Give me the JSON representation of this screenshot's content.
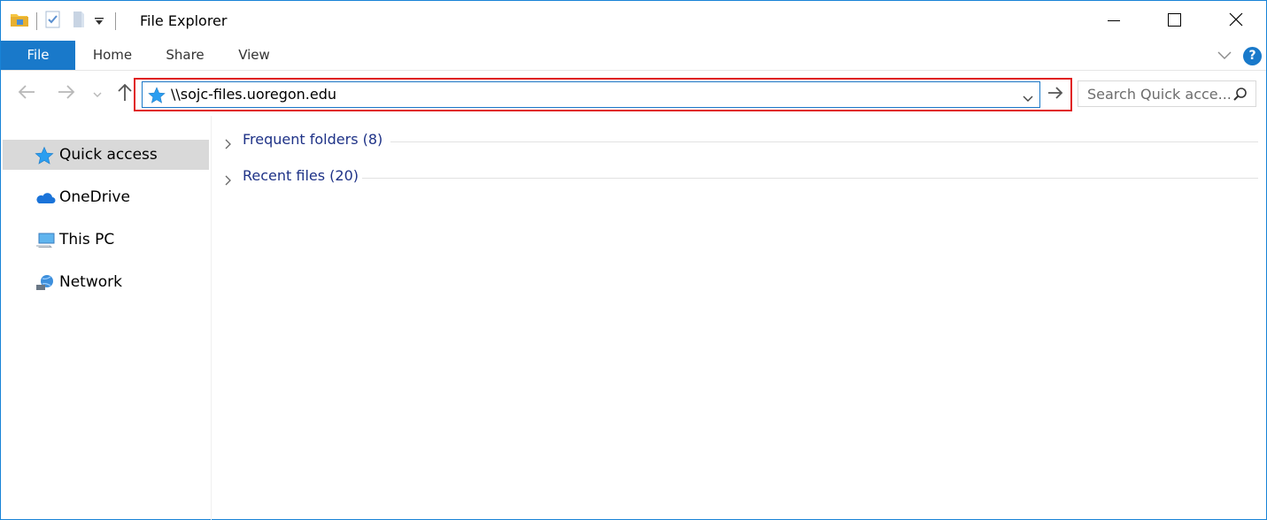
{
  "window": {
    "title": "File Explorer",
    "accent": "#1979ca"
  },
  "quick_access_toolbar": {
    "icons": [
      "folder-icon",
      "properties-checkbox-icon",
      "new-folder-icon",
      "customize-dropdown-icon"
    ]
  },
  "window_controls": [
    "minimize",
    "maximize",
    "close"
  ],
  "ribbon": {
    "tabs": [
      {
        "label": "File",
        "active": true
      },
      {
        "label": "Home"
      },
      {
        "label": "Share"
      },
      {
        "label": "View"
      }
    ],
    "help_label": "?"
  },
  "address_bar": {
    "value": "\\\\sojc-files.uoregon.edu",
    "highlight_color": "#e01e1e"
  },
  "search": {
    "placeholder": "Search Quick acce..."
  },
  "sidebar": {
    "items": [
      {
        "label": "Quick access",
        "icon": "quick-access-star-icon",
        "selected": true
      },
      {
        "label": "OneDrive",
        "icon": "onedrive-cloud-icon"
      },
      {
        "label": "This PC",
        "icon": "this-pc-icon"
      },
      {
        "label": "Network",
        "icon": "network-icon"
      }
    ]
  },
  "content": {
    "groups": [
      {
        "label": "Frequent folders (8)"
      },
      {
        "label": "Recent files (20)"
      }
    ]
  }
}
